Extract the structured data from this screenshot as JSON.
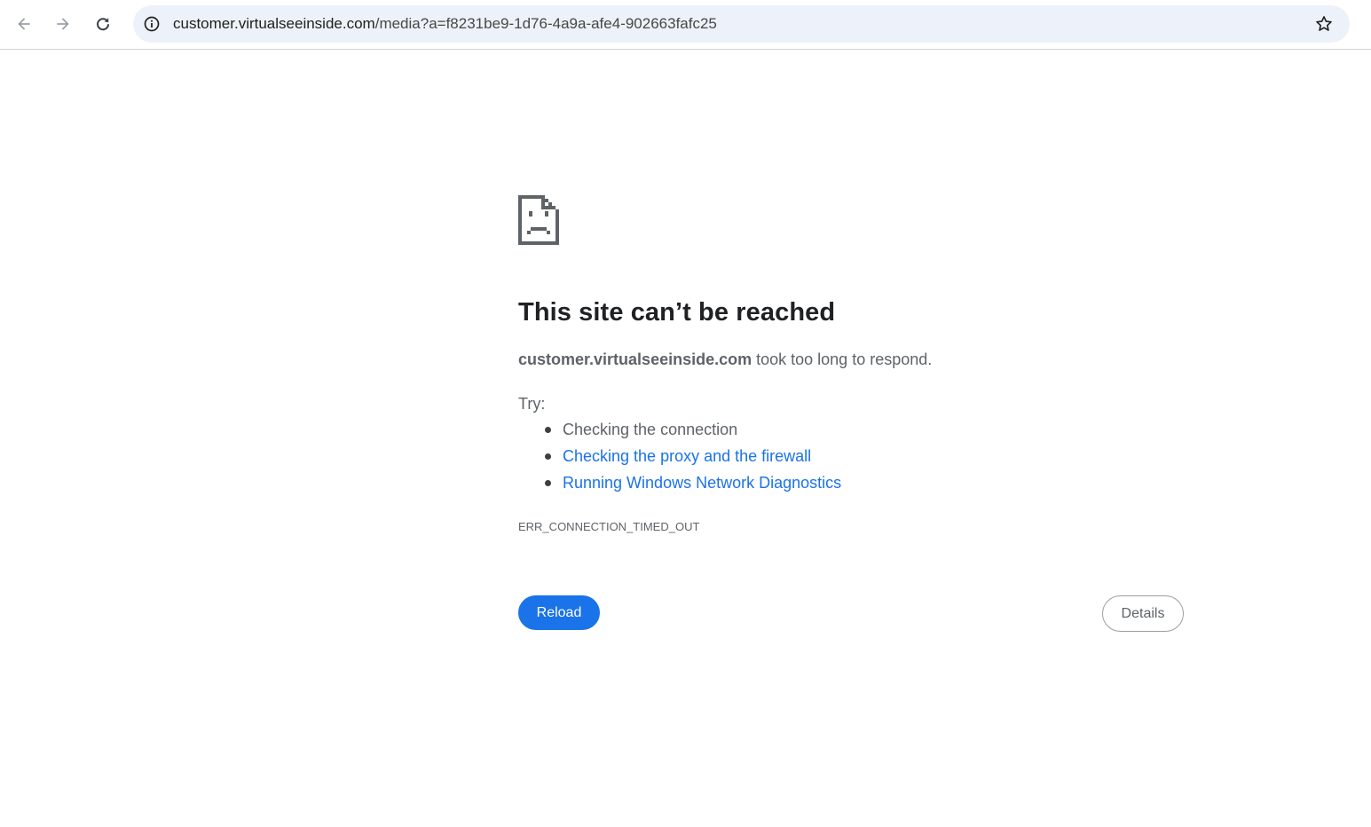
{
  "browser": {
    "url_host": "customer.virtualseeinside.com",
    "url_path": "/media?a=f8231be9-1d76-4a9a-afe4-902663fafc25",
    "icons": {
      "back": "arrow-left-icon",
      "forward": "arrow-right-icon",
      "reload": "reload-icon",
      "site_info": "info-circle-icon",
      "bookmark": "star-outline-icon"
    }
  },
  "error": {
    "icon": "sad-page-icon",
    "title": "This site can’t be reached",
    "host": "customer.virtualseeinside.com",
    "message": " took too long to respond.",
    "try_label": "Try:",
    "suggestions": [
      {
        "text": "Checking the connection",
        "is_link": false
      },
      {
        "text": "Checking the proxy and the firewall",
        "is_link": true
      },
      {
        "text": "Running Windows Network Diagnostics",
        "is_link": true
      }
    ],
    "code": "ERR_CONNECTION_TIMED_OUT",
    "reload_label": "Reload",
    "details_label": "Details"
  },
  "colors": {
    "accent": "#1a73e8",
    "omnibox_bg": "#edf2fa",
    "text_secondary": "#5f6368",
    "title_text": "#202124"
  }
}
